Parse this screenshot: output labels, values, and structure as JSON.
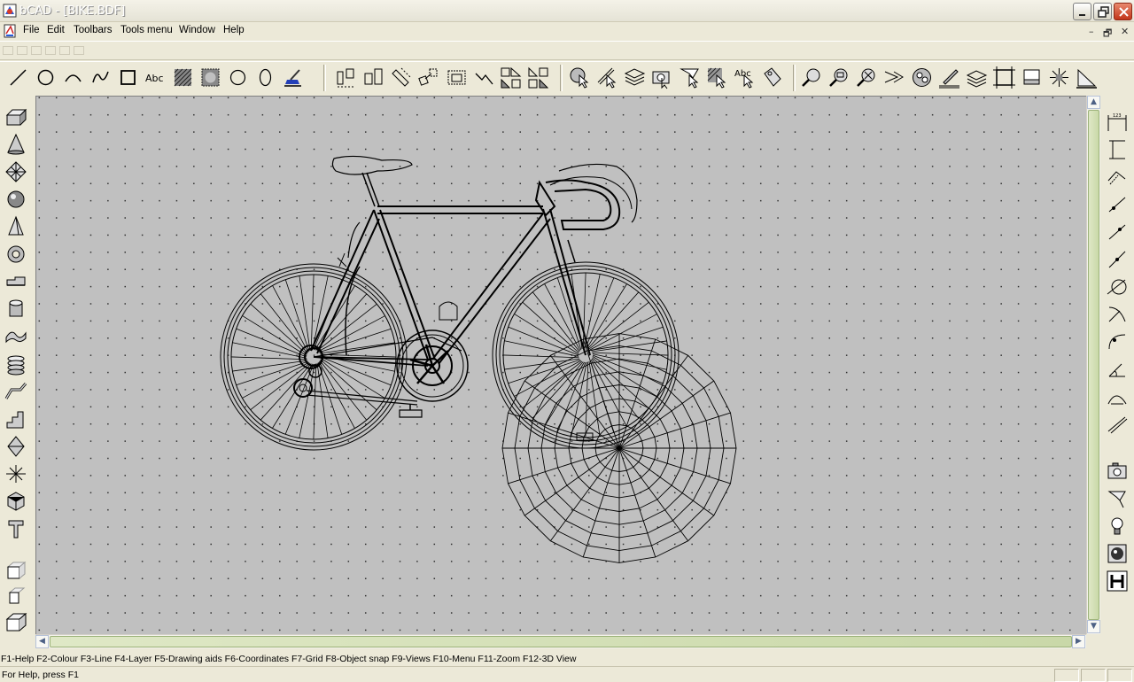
{
  "window": {
    "title": "bCAD - [BIKE.BDF]",
    "controls": [
      "minimize",
      "restore",
      "close"
    ]
  },
  "menu": {
    "items": [
      {
        "label": "File"
      },
      {
        "label": "Edit"
      },
      {
        "label": "Toolbars"
      },
      {
        "label": "Tools menu"
      },
      {
        "label": "Window"
      },
      {
        "label": "Help"
      }
    ],
    "mdi_controls": [
      "–",
      "🗗",
      "✕"
    ]
  },
  "toolbar": {
    "groups": [
      [
        "line-tool-icon",
        "circle-tool-icon",
        "arc-tool-icon",
        "spline-tool-icon",
        "rectangle-tool-icon",
        "text-tool-icon",
        "hatch-tool-icon",
        "fill-tool-icon",
        "circle2-tool-icon",
        "ellipse-tool-icon",
        "paint-tool-icon"
      ],
      [
        "align-tool-icon",
        "align2-tool-icon",
        "rotate-tool-icon",
        "move-tool-icon",
        "scale-tool-icon",
        "undo-tool-icon",
        "mirror-tool-icon",
        "array-tool-icon"
      ],
      [
        "select-tool-icon",
        "edit-tool-icon",
        "layers-tool-icon",
        "camera-tool-icon",
        "pick-tool-icon",
        "hatch-select-icon",
        "text-select-icon",
        "tag-tool-icon"
      ],
      [
        "zoom-in-icon",
        "zoom-out-icon",
        "zoom-window-icon",
        "view-icon",
        "render-icon",
        "pen-tool-icon",
        "layers2-icon",
        "frame-icon",
        "block-icon",
        "explode-icon",
        "ruler-icon"
      ]
    ],
    "text_tool_label": "Abc"
  },
  "left_toolbar": {
    "icons": [
      "box-icon",
      "cone-icon",
      "mesh-icon",
      "sphere-icon",
      "pyramid-icon",
      "torus-icon",
      "extrude-icon",
      "cylinder-icon",
      "surface-icon",
      "layers3d-icon",
      "sweep-icon",
      "stairs-icon",
      "loft-icon",
      "section-icon",
      "solid-icon",
      "text3d-icon",
      "view3d-front-icon",
      "view3d-side-icon",
      "view3d-iso-icon"
    ]
  },
  "right_toolbar": {
    "icons": [
      "dim-horizontal-icon",
      "dim-vertical-icon",
      "dim-aligned-icon",
      "dim-diagonal-icon",
      "dim-angle-icon",
      "dim-leader-icon",
      "dim-diameter-icon",
      "dim-radius-icon",
      "dim-arc-icon",
      "dim-angular-icon",
      "dim-chord-icon",
      "dim-slope-icon",
      "camera-icon",
      "light-spot-icon",
      "light-bulb-icon",
      "material-icon",
      "hatch-render-icon"
    ]
  },
  "canvas": {
    "background": "#c0c0c0",
    "grid": true,
    "drawing": "bicycle wireframe"
  },
  "function_keys": "F1-Help F2-Colour F3-Line F4-Layer F5-Drawing aids F6-Coordinates F7-Grid F8-Object snap F9-Views F10-Menu F11-Zoom F12-3D View",
  "status": {
    "text": "For Help, press F1"
  }
}
